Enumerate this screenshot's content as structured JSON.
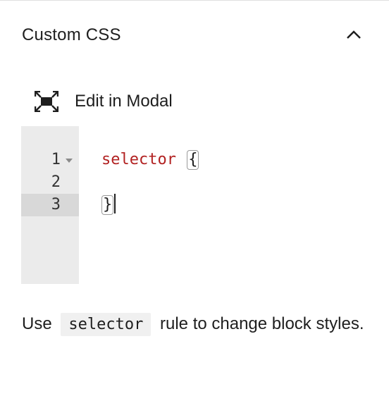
{
  "panel": {
    "title": "Custom CSS",
    "toggle_icon": "chevron-up-icon"
  },
  "modal_button": {
    "label": "Edit in Modal",
    "icon": "fullscreen-icon"
  },
  "editor": {
    "line_numbers": [
      "1",
      "2",
      "3"
    ],
    "lines": [
      {
        "selector": "selector",
        "brace": "{"
      },
      {
        "text": ""
      },
      {
        "brace": "}"
      }
    ],
    "active_line": 3,
    "fold_icon": "triangle-down-icon"
  },
  "help": {
    "before": "Use",
    "code": "selector",
    "after": "rule to change block styles."
  }
}
